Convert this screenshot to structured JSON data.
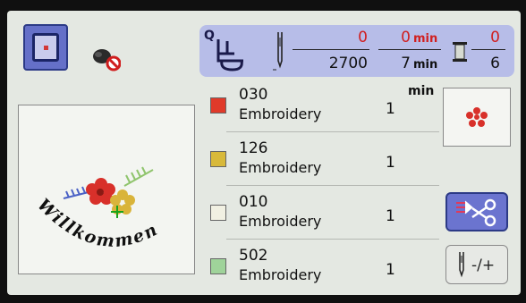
{
  "header": {
    "frame_button": {
      "icon": "embroidery-frame-icon"
    },
    "trim_icon": "no-thread-trim-icon"
  },
  "status": {
    "q_label": "Q",
    "stitch_count": "0",
    "stitch_total": "2700",
    "time_elapsed": "0",
    "time_elapsed_unit": "min",
    "time_total": "7",
    "time_total_unit": "min",
    "color_current": "0",
    "color_total": "6"
  },
  "list_time_unit": "min",
  "threads": [
    {
      "code": "030",
      "name": "Embroidery",
      "time": "1",
      "color": "#e03a2a"
    },
    {
      "code": "126",
      "name": "Embroidery",
      "time": "1",
      "color": "#d8b93a"
    },
    {
      "code": "010",
      "name": "Embroidery",
      "time": "1",
      "color": "#f1f0e2"
    },
    {
      "code": "502",
      "name": "Embroidery",
      "time": "1",
      "color": "#9fd39a"
    }
  ],
  "preview": {
    "text": "Willkommen"
  },
  "buttons": {
    "cut_icon": "thread-cut-icon",
    "needle_label": "-/+",
    "needle_icon": "needle-icon"
  }
}
